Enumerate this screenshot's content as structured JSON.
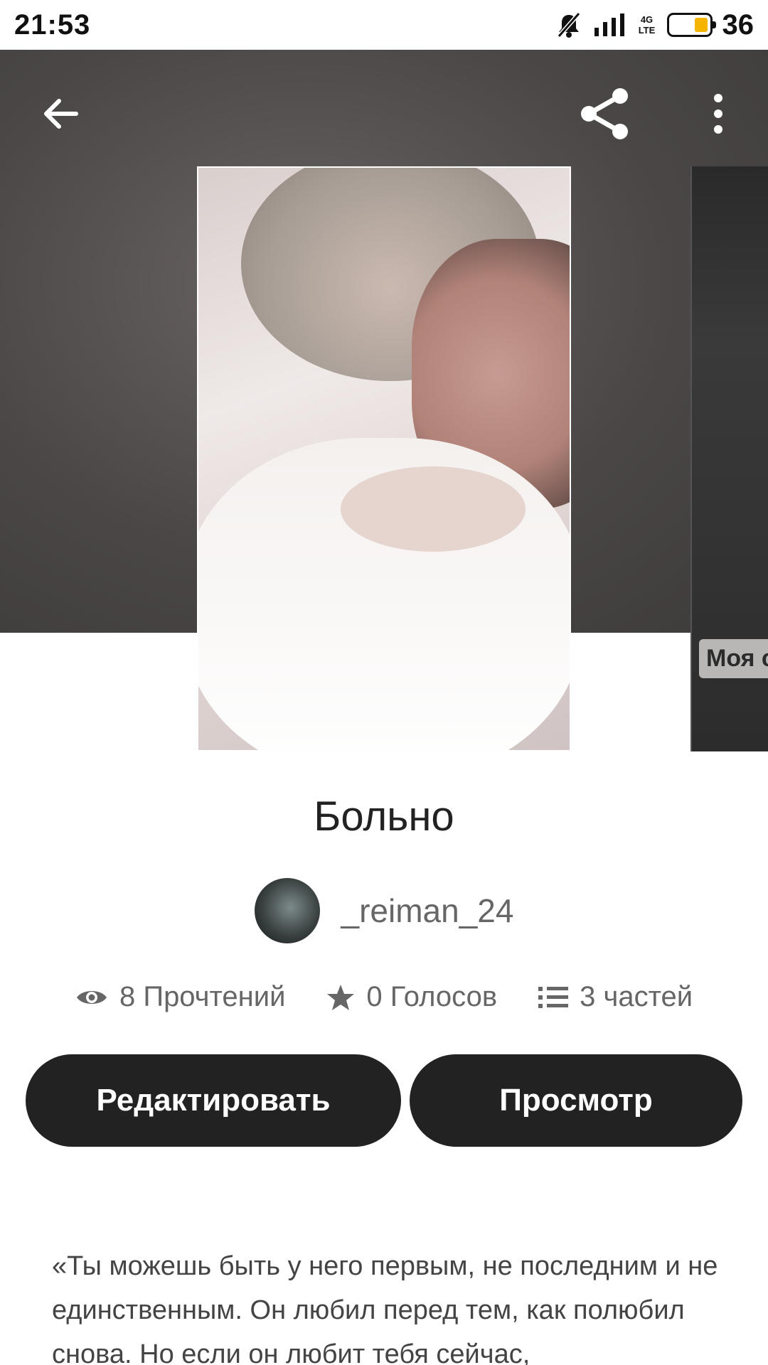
{
  "status_bar": {
    "time": "21:53",
    "network": "4G LTE",
    "battery": "36",
    "icons": [
      "mute-icon",
      "signal-icon",
      "battery-icon"
    ]
  },
  "toolbar": {
    "icons": [
      "back-arrow-icon",
      "share-icon",
      "more-vertical-icon"
    ]
  },
  "next_cover": {
    "tag": "Моя с"
  },
  "story": {
    "title": "Больно",
    "author": "_reiman_24",
    "stats": {
      "reads": "8 Прочтений",
      "votes": "0 Голосов",
      "parts": "3 частей"
    },
    "description": "«Ты можешь быть у него первым, не последним и не единственным. Он любил перед тем, как полюбил снова. Но если он любит тебя сейчас,"
  },
  "buttons": {
    "edit": "Редактировать",
    "view": "Просмотр"
  },
  "colors": {
    "button_bg": "#222222",
    "hero_bg": "#4b4747",
    "battery_fill": "#f4b400"
  }
}
